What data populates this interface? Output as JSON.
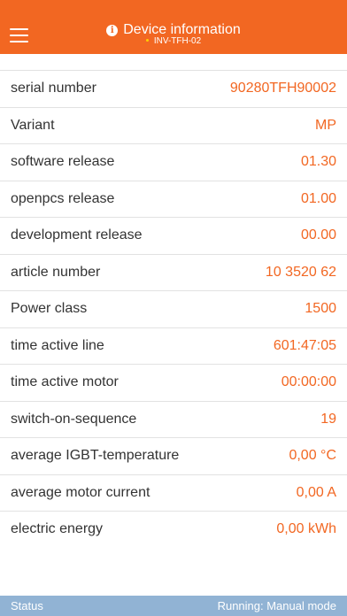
{
  "header": {
    "title": "Device information",
    "subtitle": "INV-TFH-02",
    "info_icon": "info-icon",
    "menu_icon": "hamburger-menu-icon",
    "accent_color": "#f26722"
  },
  "rows": [
    {
      "label": "serial number",
      "value": "90280TFH90002"
    },
    {
      "label": "Variant",
      "value": "MP"
    },
    {
      "label": "software release",
      "value": "01.30"
    },
    {
      "label": "openpcs release",
      "value": "01.00"
    },
    {
      "label": "development release",
      "value": "00.00"
    },
    {
      "label": "article number",
      "value": "10 3520 62"
    },
    {
      "label": "Power class",
      "value": "1500"
    },
    {
      "label": "time active line",
      "value": "601:47:05"
    },
    {
      "label": "time active motor",
      "value": "00:00:00"
    },
    {
      "label": "switch-on-sequence",
      "value": "19"
    },
    {
      "label": "average IGBT-temperature",
      "value": "0,00 °C"
    },
    {
      "label": "average motor current",
      "value": "0,00 A"
    },
    {
      "label": "electric energy",
      "value": "0,00 kWh"
    }
  ],
  "statusbar": {
    "left": "Status",
    "right": "Running: Manual mode",
    "color": "#91b3d4"
  }
}
